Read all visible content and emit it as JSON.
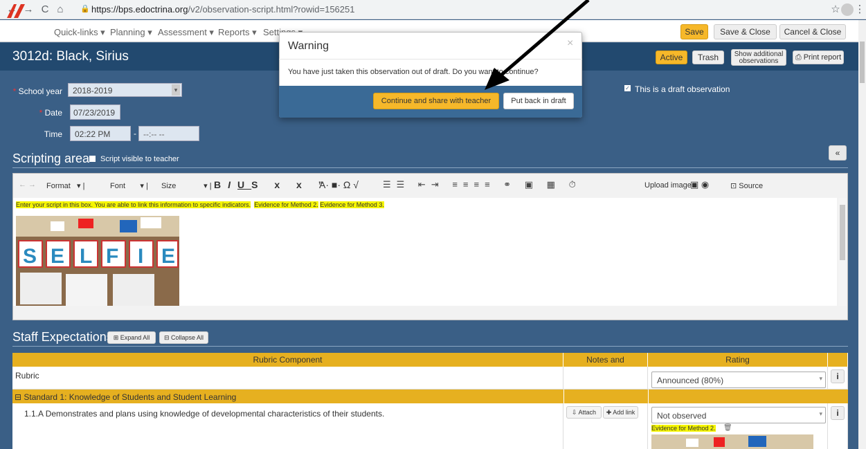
{
  "browser": {
    "url_domain": "https://bps.edoctrina.org",
    "url_path": "/v2/observation-script.html?rowid=156251"
  },
  "nav": {
    "menus": [
      "Quick-links ▾",
      "Planning ▾",
      "Assessment ▾",
      "Reports ▾",
      "Settings ▾"
    ],
    "save": "Save",
    "save_close": "Save & Close",
    "cancel_close": "Cancel & Close"
  },
  "header": {
    "title": "3012d: Black, Sirius",
    "active": "Active",
    "trash": "Trash",
    "show_additional_1": "Show additional",
    "show_additional_2": "observations",
    "print": "Print report"
  },
  "form": {
    "school_year_label": "School year",
    "school_year_value": "2018-2019",
    "date_label": "Date",
    "date_value": "07/23/2019",
    "time_label": "Time",
    "time_start": "02:22 PM",
    "time_sep": "-",
    "time_end": "--:-- --",
    "draft_label": "This is a draft observation"
  },
  "scripting": {
    "title": "Scripting area",
    "visible_label": "Script visible to teacher",
    "collapse": "«",
    "toolbar": {
      "format": "Format",
      "font": "Font",
      "size": "Size",
      "upload_image": "Upload image",
      "source": "Source"
    },
    "text": "Enter your script in this box.  You are able to link this information to specific indicators.",
    "evidence_2": "Evidence for Method 2.",
    "evidence_3": "Evidence for Method 3."
  },
  "staff": {
    "title": "Staff Expectations",
    "expand": "Expand All",
    "collapse": "Collapse All",
    "headers": [
      "Rubric Component",
      "Notes and Attachments",
      "Rating"
    ],
    "rubric_label": "Rubric",
    "rubric_value": "Announced (80%)",
    "standard": "Standard 1: Knowledge of Students and Student Learning",
    "row_text": "1.1.A Demonstrates and plans using knowledge of developmental characteristics of their students.",
    "attach": "Attach",
    "add_link": "Add link",
    "rating": "Not observed",
    "row_evidence": "Evidence for Method 2.",
    "info": "i"
  },
  "modal": {
    "title": "Warning",
    "close": "×",
    "message": "You have just taken this observation out of draft. Do you want to continue?",
    "continue": "Continue and share with teacher",
    "back_draft": "Put back in draft"
  },
  "colors": {
    "accent_yellow": "#f6b82a",
    "header_blue": "#22496f",
    "body_blue": "#3a5f86",
    "highlight": "#f5f500"
  }
}
